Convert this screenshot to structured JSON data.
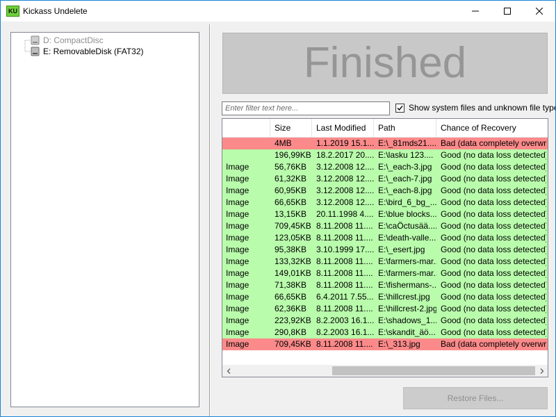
{
  "window": {
    "app_icon_text": "KU",
    "title": "Kickass Undelete"
  },
  "drives": [
    {
      "label": "D: CompactDisc",
      "enabled": false
    },
    {
      "label": "E: RemovableDisk (FAT32)",
      "enabled": true
    }
  ],
  "status": {
    "text": "Finished"
  },
  "filter": {
    "placeholder": "Enter filter text here...",
    "value": ""
  },
  "show_system_files": {
    "label": "Show system files and unknown file types",
    "checked": true
  },
  "table": {
    "columns": [
      "",
      "Size",
      "Last Modified",
      "Path",
      "Chance of Recovery"
    ],
    "rows": [
      {
        "type": "",
        "size": "4MB",
        "modified": "1.1.2019 15.1...",
        "path": "E:\\_81mds21....",
        "chance": "Bad (data completely overwrit...",
        "status": "bad"
      },
      {
        "type": "",
        "size": "196,99KB",
        "modified": "18.2.2017 20....",
        "path": "E:\\lasku 123....",
        "chance": "Good (no data loss detected)",
        "status": "good"
      },
      {
        "type": "Image",
        "size": "56,76KB",
        "modified": "3.12.2008 12....",
        "path": "E:\\_each-3.jpg",
        "chance": "Good (no data loss detected)",
        "status": "good"
      },
      {
        "type": "Image",
        "size": "61,32KB",
        "modified": "3.12.2008 12....",
        "path": "E:\\_each-7.jpg",
        "chance": "Good (no data loss detected)",
        "status": "good"
      },
      {
        "type": "Image",
        "size": "60,95KB",
        "modified": "3.12.2008 12....",
        "path": "E:\\_each-8.jpg",
        "chance": "Good (no data loss detected)",
        "status": "good"
      },
      {
        "type": "Image",
        "size": "66,65KB",
        "modified": "3.12.2008 12....",
        "path": "E:\\bird_6_bg_...",
        "chance": "Good (no data loss detected)",
        "status": "good"
      },
      {
        "type": "Image",
        "size": "13,15KB",
        "modified": "20.11.1998 4....",
        "path": "E:\\blue blocks....",
        "chance": "Good (no data loss detected)",
        "status": "good"
      },
      {
        "type": "Image",
        "size": "709,45KB",
        "modified": "8.11.2008 11....",
        "path": "E:\\caÖctusää....",
        "chance": "Good (no data loss detected)",
        "status": "good"
      },
      {
        "type": "Image",
        "size": "123,05KB",
        "modified": "8.11.2008 11....",
        "path": "E:\\death-valle...",
        "chance": "Good (no data loss detected)",
        "status": "good"
      },
      {
        "type": "Image",
        "size": "95,38KB",
        "modified": "3.10.1999 17....",
        "path": "E:\\_esert.jpg",
        "chance": "Good (no data loss detected)",
        "status": "good"
      },
      {
        "type": "Image",
        "size": "133,32KB",
        "modified": "8.11.2008 11....",
        "path": "E:\\farmers-mar...",
        "chance": "Good (no data loss detected)",
        "status": "good"
      },
      {
        "type": "Image",
        "size": "149,01KB",
        "modified": "8.11.2008 11....",
        "path": "E:\\farmers-mar...",
        "chance": "Good (no data loss detected)",
        "status": "good"
      },
      {
        "type": "Image",
        "size": "71,38KB",
        "modified": "8.11.2008 11....",
        "path": "E:\\fishermans-...",
        "chance": "Good (no data loss detected)",
        "status": "good"
      },
      {
        "type": "Image",
        "size": "66,65KB",
        "modified": "6.4.2011 7.55...",
        "path": "E:\\hillcrest.jpg",
        "chance": "Good (no data loss detected)",
        "status": "good"
      },
      {
        "type": "Image",
        "size": "62,36KB",
        "modified": "8.11.2008 11....",
        "path": "E:\\hillcrest-2.jpg",
        "chance": "Good (no data loss detected)",
        "status": "good"
      },
      {
        "type": "Image",
        "size": "223,92KB",
        "modified": "8.2.2003 16.1...",
        "path": "E:\\shadows_1...",
        "chance": "Good (no data loss detected)",
        "status": "good"
      },
      {
        "type": "Image",
        "size": "290,8KB",
        "modified": "8.2.2003 16.1...",
        "path": "E:\\skandit_äö...",
        "chance": "Good (no data loss detected)",
        "status": "good"
      },
      {
        "type": "Image",
        "size": "709,45KB",
        "modified": "8.11.2008 11....",
        "path": "E:\\_313.jpg",
        "chance": "Bad (data completely overwrit...",
        "status": "bad"
      }
    ]
  },
  "restore_button": {
    "label": "Restore Files..."
  },
  "colors": {
    "good_row": "#b9fcac",
    "bad_row": "#fc8a8a",
    "banner_bg": "#c8c8c8",
    "banner_text": "#969696",
    "window_border": "#1883d7"
  }
}
